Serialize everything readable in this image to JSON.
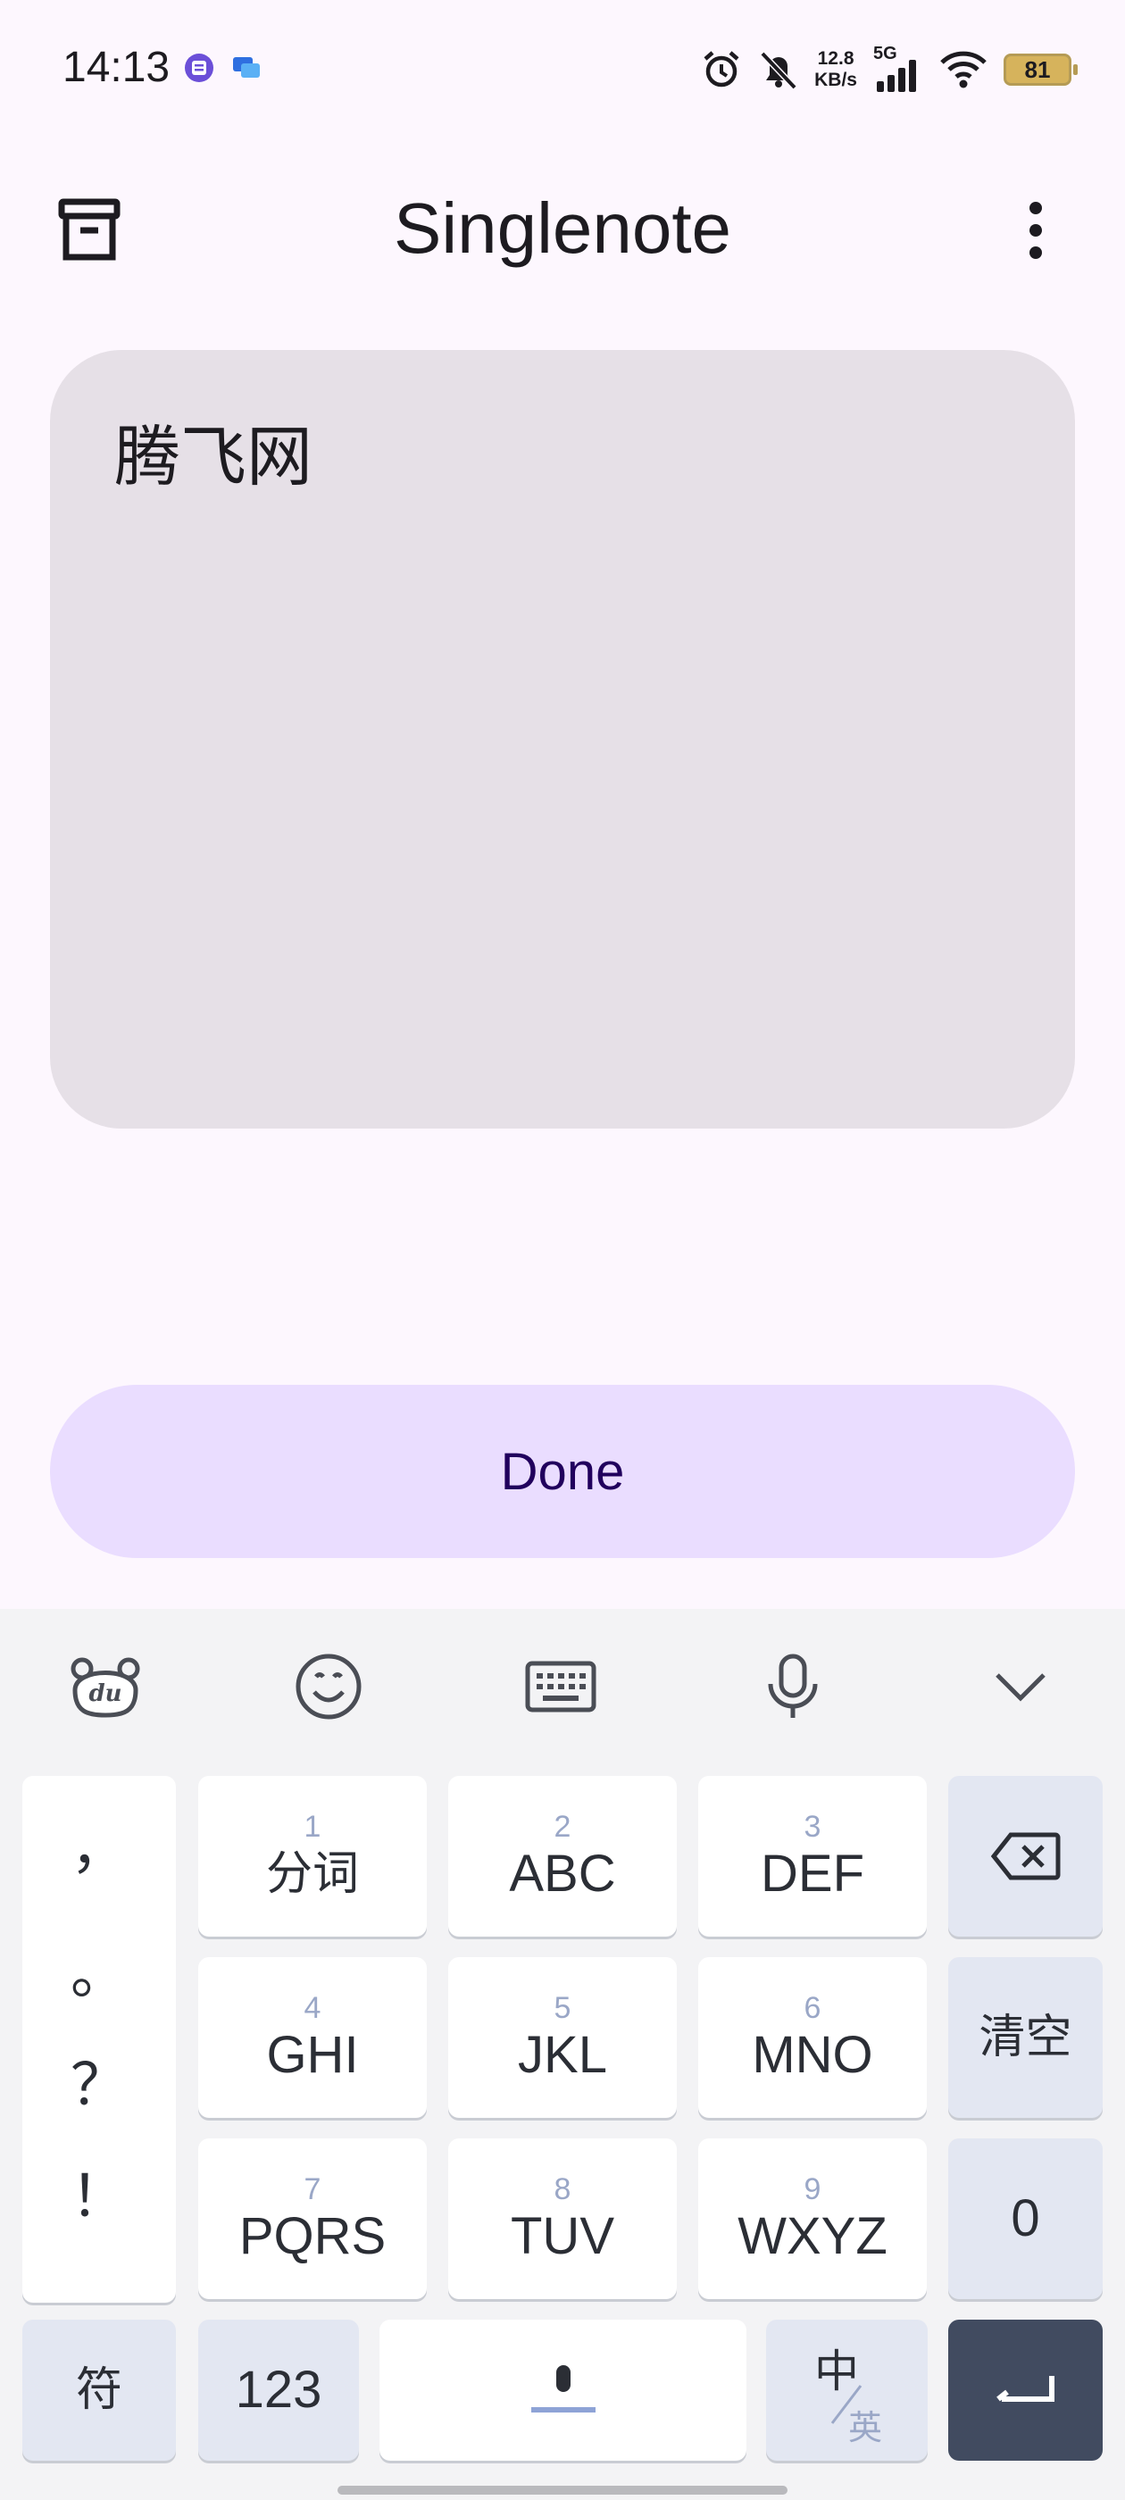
{
  "status_bar": {
    "time": "14:13",
    "net_speed_value": "12.8",
    "net_speed_unit": "KB/s",
    "network_type": "5G",
    "battery": "81",
    "icons": [
      "notification-app-icon",
      "message-app-icon",
      "alarm-icon",
      "mute-bell-icon",
      "signal-icon",
      "wifi-icon",
      "battery-icon"
    ]
  },
  "app_bar": {
    "title": "Singlenote",
    "left_icon": "archive-icon",
    "right_icon": "more-vert-icon"
  },
  "note": {
    "text": "腾飞网"
  },
  "done_label": "Done",
  "keyboard": {
    "toolbar_icons": [
      "du-bear-icon",
      "emoji-icon",
      "keyboard-icon",
      "microphone-icon",
      "chevron-down-icon"
    ],
    "punctuation": [
      "，",
      "。",
      "？",
      "！"
    ],
    "keys": {
      "k1": {
        "num": "1",
        "label": "分词"
      },
      "k2": {
        "num": "2",
        "label": "ABC"
      },
      "k3": {
        "num": "3",
        "label": "DEF"
      },
      "k4": {
        "num": "4",
        "label": "GHI"
      },
      "k5": {
        "num": "5",
        "label": "JKL"
      },
      "k6": {
        "num": "6",
        "label": "MNO"
      },
      "k7": {
        "num": "7",
        "label": "PQRS"
      },
      "k8": {
        "num": "8",
        "label": "TUV"
      },
      "k9": {
        "num": "9",
        "label": "WXYZ"
      }
    },
    "clear_label": "清空",
    "zero_label": "0",
    "symbol_label": "符",
    "numeric_label": "123",
    "lang_primary": "中",
    "lang_secondary": "英"
  }
}
